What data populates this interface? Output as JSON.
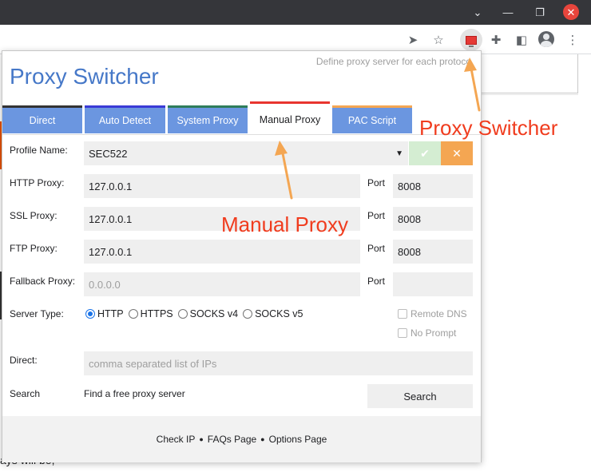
{
  "browser": {
    "icons": [
      "chevron-down-icon",
      "minimize-icon",
      "restore-icon",
      "close-icon",
      "send-icon",
      "star-icon",
      "proxy-switcher-extension-icon",
      "puzzle-icon",
      "side-panel-icon",
      "profile-icon",
      "more-icon"
    ]
  },
  "background": {
    "partial_text": "ays will be,"
  },
  "popup": {
    "tagline": "Define proxy server for each protoco",
    "title": "Proxy Switcher",
    "tabs": [
      {
        "label": "Direct",
        "color": "#333333"
      },
      {
        "label": "Auto Detect",
        "color": "#3a3ad6"
      },
      {
        "label": "System Proxy",
        "color": "#2e7d5b"
      },
      {
        "label": "Manual Proxy",
        "color": "#e8352f",
        "active": true
      },
      {
        "label": "PAC Script",
        "color": "#f4a652"
      }
    ],
    "profile": {
      "label": "Profile Name:",
      "value": "SEC522"
    },
    "http": {
      "label": "HTTP Proxy:",
      "value": "127.0.0.1",
      "port_label": "Port",
      "port": "8008"
    },
    "ssl": {
      "label": "SSL Proxy:",
      "value": "127.0.0.1",
      "port_label": "Port",
      "port": "8008"
    },
    "ftp": {
      "label": "FTP Proxy:",
      "value": "127.0.0.1",
      "port_label": "Port",
      "port": "8008"
    },
    "fallback": {
      "label": "Fallback Proxy:",
      "placeholder": "0.0.0.0",
      "port_label": "Port",
      "port": ""
    },
    "server_type": {
      "label": "Server Type:",
      "options": [
        "HTTP",
        "HTTPS",
        "SOCKS v4",
        "SOCKS v5"
      ],
      "selected": "HTTP"
    },
    "remote_dns": {
      "label": "Remote DNS",
      "checked": false
    },
    "no_prompt": {
      "label": "No Prompt",
      "checked": false
    },
    "direct": {
      "label": "Direct:",
      "placeholder": "comma separated list of IPs"
    },
    "search": {
      "label": "Search",
      "text": "Find a free proxy server",
      "button": "Search"
    },
    "footer": {
      "links": [
        "Check IP",
        "FAQs Page",
        "Options Page"
      ],
      "separator": "●"
    }
  },
  "annotations": {
    "proxy_switcher": "Proxy Switcher",
    "manual_proxy": "Manual Proxy",
    "color": "#f03c1e",
    "arrow_color": "#f4a652"
  }
}
